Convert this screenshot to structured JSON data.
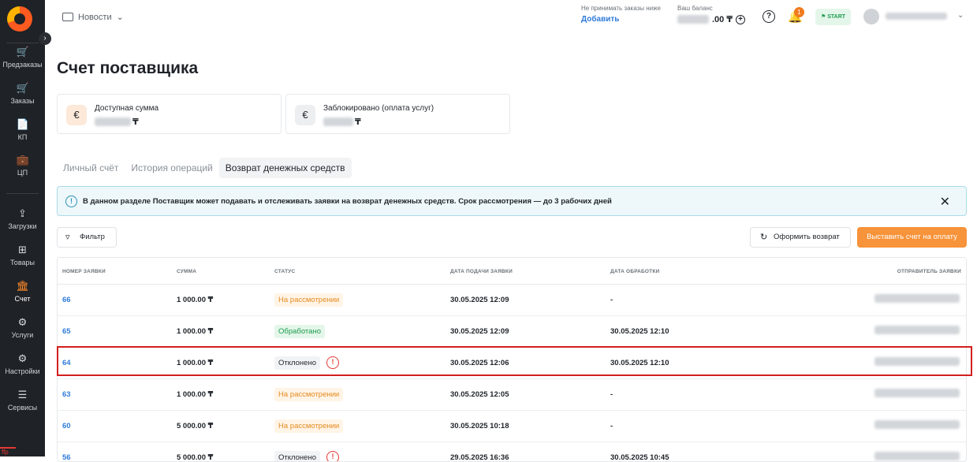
{
  "sidebar": {
    "items": [
      {
        "label": "Предзаказы",
        "icon": "preorders-icon"
      },
      {
        "label": "Заказы",
        "icon": "orders-icon"
      },
      {
        "label": "КП",
        "icon": "kp-icon"
      },
      {
        "label": "ЦП",
        "icon": "cp-icon"
      },
      {
        "label": "Загрузки",
        "icon": "uploads-icon"
      },
      {
        "label": "Товары",
        "icon": "products-icon"
      },
      {
        "label": "Счет",
        "icon": "bank-icon"
      },
      {
        "label": "Услуги",
        "icon": "services-icon"
      },
      {
        "label": "Настройки",
        "icon": "settings-icon"
      },
      {
        "label": "Сервисы",
        "icon": "menu-icon"
      }
    ],
    "bottom_text": "ffp"
  },
  "topbar": {
    "news_label": "Новости",
    "no_orders_label": "Не принимать заказы ниже",
    "add_label": "Добавить",
    "balance_label": "Ваш баланс",
    "balance_suffix": ".00 ₸",
    "notification_count": "1",
    "start_label": "START"
  },
  "page": {
    "title": "Счет поставщика",
    "cards": [
      {
        "label": "Доступная сумма",
        "currency": "₸"
      },
      {
        "label": "Заблокировано (оплата услуг)",
        "currency": "₸"
      }
    ],
    "tabs": [
      "Личный счёт",
      "История операций",
      "Возврат денежных средств"
    ],
    "info_text": "В данном разделе Поставщик может подавать и отслеживать заявки на возврат денежных средств. Срок рассмотрения — до 3 рабочих дней",
    "filter_label": "Фильтр",
    "refund_label": "Оформить возврат",
    "invoice_label": "Выставить счет на оплату"
  },
  "table": {
    "headers": [
      "НОМЕР ЗАЯВКИ",
      "СУММА",
      "СТАТУС",
      "ДАТА ПОДАЧИ ЗАЯВКИ",
      "ДАТА ОБРАБОТКИ",
      "ОТПРАВИТЕЛЬ ЗАЯВКИ"
    ],
    "rows": [
      {
        "num": "66",
        "sum": "1 000.00 ₸",
        "status": "На рассмотрении",
        "submitted": "30.05.2025 12:09",
        "processed": "-"
      },
      {
        "num": "65",
        "sum": "1 000.00 ₸",
        "status": "Обработано",
        "submitted": "30.05.2025 12:09",
        "processed": "30.05.2025 12:10"
      },
      {
        "num": "64",
        "sum": "1 000.00 ₸",
        "status": "Отклонено",
        "submitted": "30.05.2025 12:06",
        "processed": "30.05.2025 12:10"
      },
      {
        "num": "63",
        "sum": "1 000.00 ₸",
        "status": "На рассмотрении",
        "submitted": "30.05.2025 12:05",
        "processed": "-"
      },
      {
        "num": "60",
        "sum": "5 000.00 ₸",
        "status": "На рассмотрении",
        "submitted": "30.05.2025 10:18",
        "processed": "-"
      },
      {
        "num": "56",
        "sum": "5 000.00 ₸",
        "status": "Отклонено",
        "submitted": "29.05.2025 16:36",
        "processed": "30.05.2025 10:45"
      }
    ]
  }
}
